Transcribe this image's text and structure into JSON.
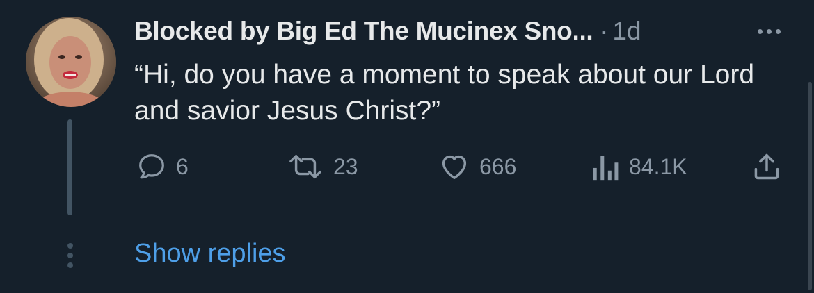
{
  "tweet": {
    "author_name": "Blocked by Big Ed The Mucinex Sno...",
    "separator": "·",
    "time": "1d",
    "text": "“Hi, do you have a moment to speak about our Lord and savior Jesus Christ?”",
    "avatar_icon": "profile-photo",
    "more_icon": "more-dots-icon"
  },
  "actions": {
    "replies": {
      "icon": "reply-icon",
      "count": "6"
    },
    "reposts": {
      "icon": "repost-icon",
      "count": "23"
    },
    "likes": {
      "icon": "heart-icon",
      "count": "666"
    },
    "views": {
      "icon": "views-chart-icon",
      "count": "84.1K"
    },
    "share": {
      "icon": "share-icon"
    }
  },
  "thread": {
    "show_replies_label": "Show replies"
  },
  "colors": {
    "background": "#15202b",
    "text_primary": "#e7e9ea",
    "text_secondary": "#8b98a5",
    "link": "#4e9fe8",
    "thread_line": "#425463"
  }
}
